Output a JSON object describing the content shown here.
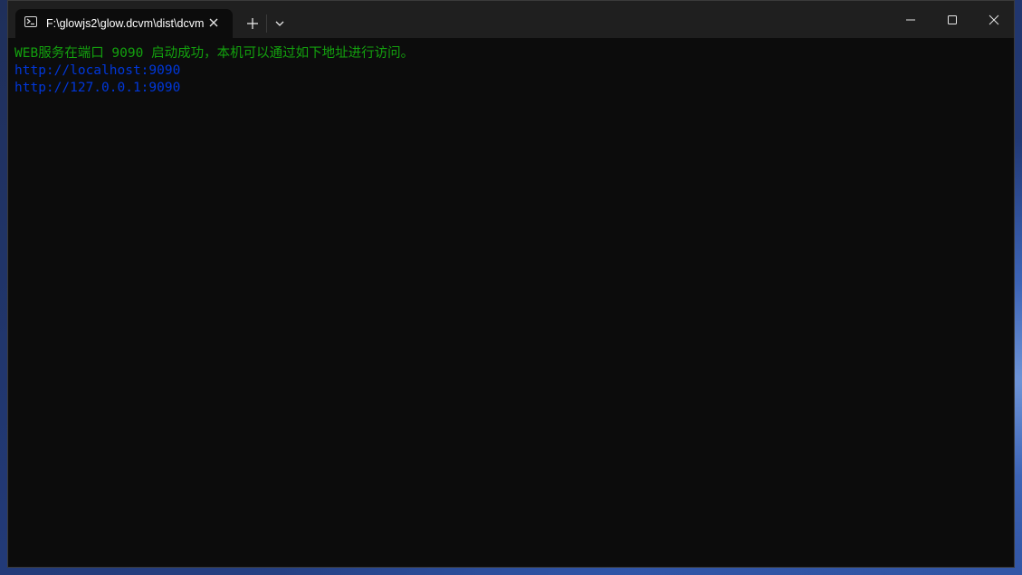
{
  "window": {
    "tab_title": "F:\\glowjs2\\glow.dcvm\\dist\\dcvm",
    "icons": {
      "tab_icon": "terminal-icon",
      "close_tab": "close-icon",
      "new_tab": "plus-icon",
      "dropdown": "chevron-down-icon",
      "minimize": "minimize-icon",
      "maximize": "maximize-icon",
      "close_window": "close-icon"
    }
  },
  "terminal": {
    "lines": [
      {
        "text": "WEB服务在端口 9090 启动成功，本机可以通过如下地址进行访问。",
        "color": "#13a10e"
      },
      {
        "text": "http://localhost:9090",
        "color": "#0037da"
      },
      {
        "text": "http://127.0.0.1:9090",
        "color": "#0037da"
      }
    ]
  },
  "colors": {
    "background": "#0c0c0c",
    "titlebar": "#1f1f1f",
    "success_text": "#13a10e",
    "url_text": "#0037da"
  }
}
